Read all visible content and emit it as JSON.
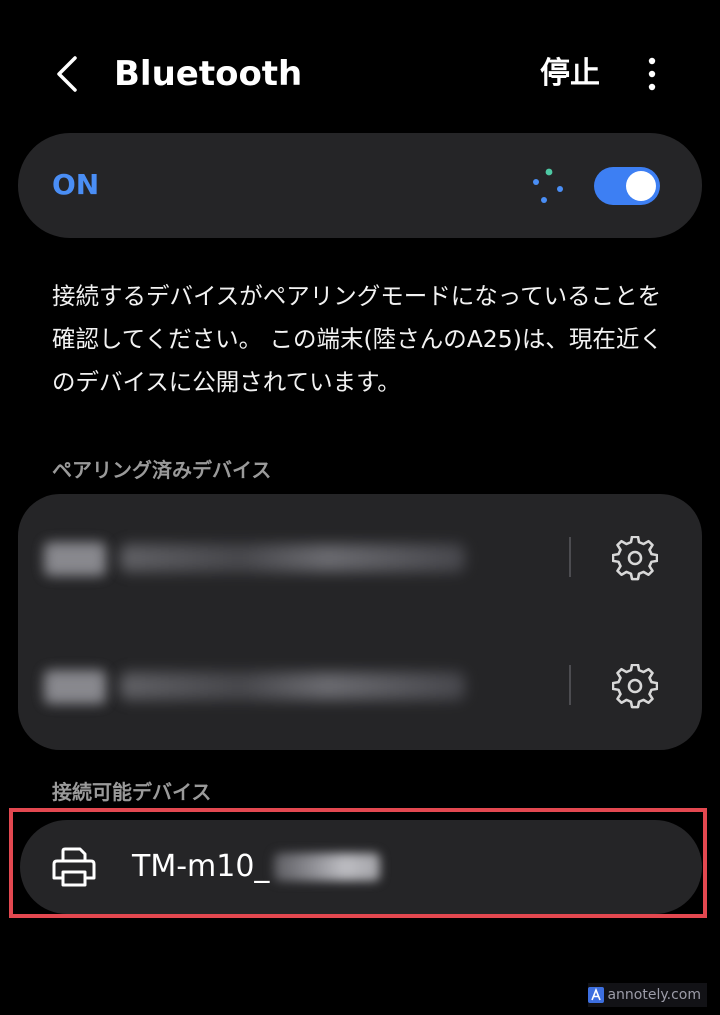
{
  "header": {
    "title": "Bluetooth",
    "stop_label": "停止"
  },
  "toggle": {
    "status_label": "ON",
    "enabled": true,
    "accent_color": "#3d7ff3"
  },
  "description": "接続するデバイスがペアリングモードになっていることを確認してください。 この端末(陸さんのA25)は、現在近くのデバイスに公開されています。",
  "paired_section": {
    "title": "ペアリング済みデバイス",
    "devices": [
      {
        "name_hidden": true,
        "icon": "headphones-icon"
      },
      {
        "name_hidden": true,
        "icon": "printer-icon"
      }
    ]
  },
  "available_section": {
    "title": "接続可能デバイス",
    "devices": [
      {
        "name": "TM-m10_",
        "icon": "printer-icon"
      }
    ]
  },
  "highlight_color": "#e34850",
  "watermark": "annotely.com"
}
